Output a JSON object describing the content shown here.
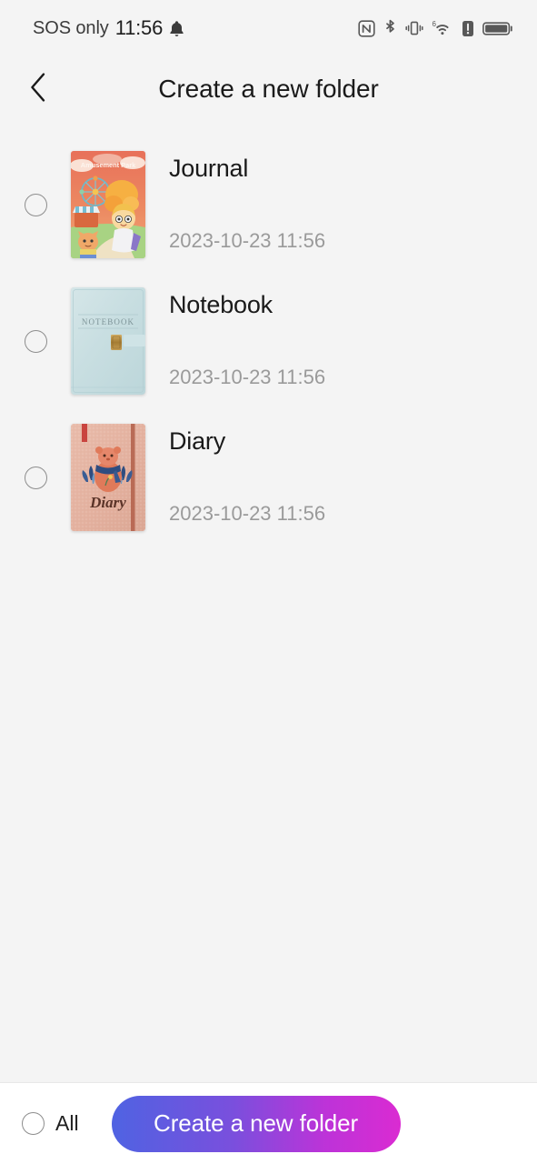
{
  "status_bar": {
    "carrier": "SOS only",
    "time": "11:56",
    "icons_left": [
      "bell-icon"
    ],
    "icons_right": [
      "nfc-icon",
      "bluetooth-icon",
      "vibrate-icon",
      "wifi-6-icon",
      "alert-icon",
      "battery-icon"
    ]
  },
  "header": {
    "back_icon": "chevron-left-icon",
    "title": "Create a new folder"
  },
  "list": {
    "items": [
      {
        "name": "Journal",
        "date": "2023-10-23 11:56",
        "selected": false,
        "cover": {
          "style": "amusement-park",
          "title": "Amusement Park",
          "bg": "#e8765a",
          "accent": "#f5b942"
        }
      },
      {
        "name": "Notebook",
        "date": "2023-10-23 11:56",
        "selected": false,
        "cover": {
          "style": "leather-notebook",
          "title": "NOTEBOOK",
          "bg": "#c7dde0",
          "accent": "#b08a3e"
        }
      },
      {
        "name": "Diary",
        "date": "2023-10-23 11:56",
        "selected": false,
        "cover": {
          "style": "bear-diary",
          "title": "Diary",
          "bg": "#e6b3a4",
          "accent": "#2e4a7d"
        }
      }
    ]
  },
  "bottom_bar": {
    "select_all_label": "All",
    "select_all_checked": false,
    "cta_label": "Create a new folder",
    "cta_gradient_start": "#4f63e2",
    "cta_gradient_end": "#da2bd2"
  }
}
